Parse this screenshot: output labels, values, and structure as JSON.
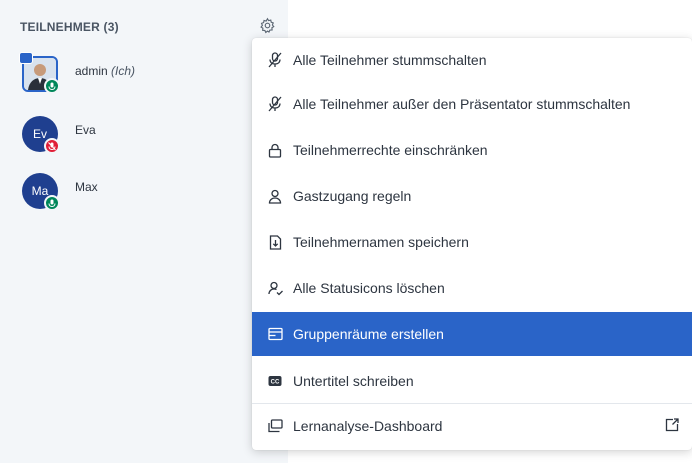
{
  "sidebar": {
    "header": "TEILNEHMER (3)",
    "users": [
      {
        "name": "admin",
        "suffix": "(Ich)",
        "initials": "",
        "status": "green"
      },
      {
        "name": "Eva",
        "suffix": "",
        "initials": "Ev",
        "status": "red"
      },
      {
        "name": "Max",
        "suffix": "",
        "initials": "Ma",
        "status": "green"
      }
    ]
  },
  "menu": {
    "items": [
      {
        "label": "Alle Teilnehmer stummschalten",
        "icon": "mute-icon"
      },
      {
        "label": "Alle Teilnehmer außer den Präsentator stummschalten",
        "icon": "mute-icon"
      },
      {
        "label": "Teilnehmerrechte einschränken",
        "icon": "lock-icon"
      },
      {
        "label": "Gastzugang regeln",
        "icon": "user-icon"
      },
      {
        "label": "Teilnehmernamen speichern",
        "icon": "download-file-icon"
      },
      {
        "label": "Alle Statusicons löschen",
        "icon": "clear-status-icon"
      },
      {
        "label": "Gruppenräume erstellen",
        "icon": "breakout-room-icon",
        "active": true
      },
      {
        "label": "Untertitel schreiben",
        "icon": "closed-captions-icon"
      },
      {
        "label": "Lernanalyse-Dashboard",
        "icon": "dashboard-icon"
      }
    ]
  },
  "colors": {
    "accent": "#2a64c8",
    "avatar": "#1f3f8f",
    "status_green": "#00875a",
    "status_red": "#e01e37",
    "sidebar_bg": "#f3f6f9"
  }
}
